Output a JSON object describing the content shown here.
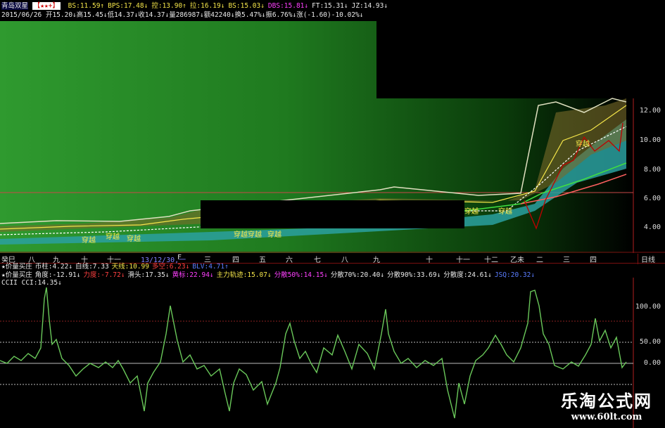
{
  "header": {
    "stock_name": "青岛双星",
    "stars": "【★★+】",
    "indicators": [
      {
        "label": "BS:11.59↑",
        "color": "#f5e64a"
      },
      {
        "label": "BPS:17.48↓",
        "color": "#f5e64a"
      },
      {
        "label": "控:13.90↑",
        "color": "#f5e64a"
      },
      {
        "label": "拉:16.19↓",
        "color": "#f5e64a"
      },
      {
        "label": "BS:15.03↓",
        "color": "#f5e64a"
      },
      {
        "label": "DBS:15.81↓",
        "color": "#ff40ff"
      },
      {
        "label": "FT:15.31↓",
        "color": "#e8e8e8"
      },
      {
        "label": "JZ:14.93↓",
        "color": "#e8e8e8"
      }
    ],
    "date": "2015/06/26",
    "ohlc": "开15.20↓高15.45↓低14.37↓收14.37↓量286987↓额42240↓换5.47%↓振6.76%↓涨(-1.60)-10.02%↓"
  },
  "price_axis": [
    "12.00",
    "10.00",
    "8.00",
    "6.00",
    "4.00"
  ],
  "cross_labels": [
    "穿越",
    "穿越",
    "穿越穿越",
    "穿越",
    "穿越",
    "穿越",
    "穿越",
    "穿越"
  ],
  "months": [
    "癸巳",
    "八",
    "九",
    "十",
    "十一",
    "13/12/30,一",
    "F",
    "三",
    "四",
    "五",
    "六",
    "七",
    "八",
    "九",
    "十",
    "十一",
    "十二",
    "乙未",
    "二",
    "三",
    "四"
  ],
  "time_btn": "日线",
  "sub1": {
    "line1": [
      {
        "t": "★价量买庄",
        "c": "#e8e8e8"
      },
      {
        "t": "币柱:4.22↓",
        "c": "#e8e8e8"
      },
      {
        "t": "白线:7.33",
        "c": "#e8e8e8"
      },
      {
        "t": "天线:10.99",
        "c": "#f5e64a"
      },
      {
        "t": "多空:6.23↓",
        "c": "#ff4040"
      },
      {
        "t": "BLV:4.71↑",
        "c": "#5a7dff"
      }
    ],
    "line2": [
      {
        "t": "★价量买庄",
        "c": "#e8e8e8"
      },
      {
        "t": "角度:-12.91↓",
        "c": "#e8e8e8"
      },
      {
        "t": "力度:-7.72↓",
        "c": "#ff4040"
      },
      {
        "t": "滑头:17.35↓",
        "c": "#e8e8e8"
      },
      {
        "t": "黄标:22.94↓",
        "c": "#ff40ff"
      },
      {
        "t": "主力轨迹:15.07↓",
        "c": "#f5e64a"
      },
      {
        "t": "分散50%:14.15↓",
        "c": "#ff40ff"
      },
      {
        "t": "分散70%:20.40↓",
        "c": "#e8e8e8"
      },
      {
        "t": "分散90%:33.69↓",
        "c": "#e8e8e8"
      },
      {
        "t": "分散度:24.61↓",
        "c": "#e8e8e8"
      },
      {
        "t": "JSQ:20.32↓",
        "c": "#5a7dff"
      }
    ]
  },
  "cci": {
    "label": "CCII CCI:14.35↓",
    "axis": [
      "100.00",
      "50.00",
      "0.00"
    ]
  },
  "watermark": {
    "cn": "乐淘公式网",
    "url": "www.60lt.com"
  }
}
